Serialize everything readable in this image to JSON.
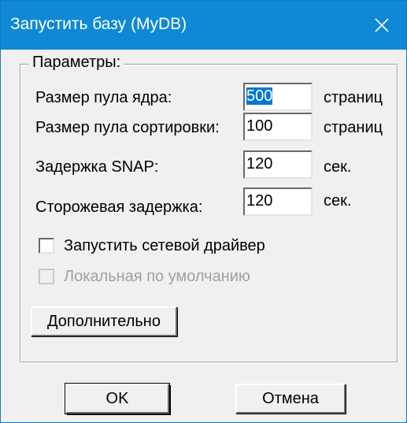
{
  "window": {
    "title": "Запустить базу (MyDB)",
    "close_icon": "close-icon"
  },
  "group": {
    "legend": "Параметры:"
  },
  "fields": [
    {
      "label": "Размер пула ядра:",
      "value": "500",
      "unit": "страниц",
      "selected": true
    },
    {
      "label": "Размер пула сортировки:",
      "value": "100",
      "unit": "страниц",
      "selected": false
    },
    {
      "label": "Задержка  SNAP:",
      "value": "120",
      "unit": "сек.",
      "selected": false
    },
    {
      "label": "Сторожевая задержка:",
      "value": "120",
      "unit": "сек.",
      "selected": false
    }
  ],
  "checkboxes": [
    {
      "label": "Запустить сетевой драйвер",
      "checked": false,
      "disabled": false
    },
    {
      "label": "Локальная по умолчанию",
      "checked": false,
      "disabled": true
    }
  ],
  "buttons": {
    "advanced": "Дополнительно",
    "ok": "OK",
    "cancel": "Отмена"
  },
  "colors": {
    "titlebar": "#0f89d5",
    "selection": "#0078d7",
    "disabled_text": "#a0a0a0"
  }
}
